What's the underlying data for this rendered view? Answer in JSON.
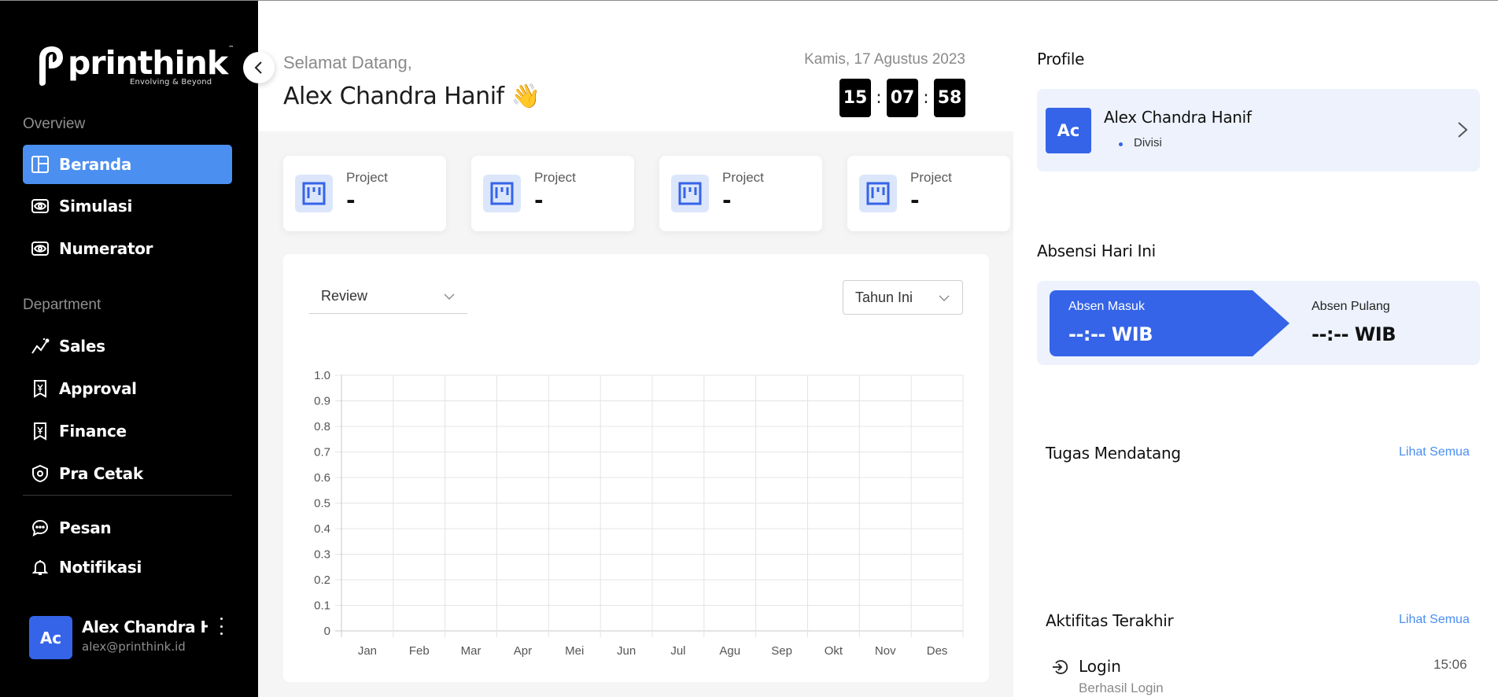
{
  "brand": {
    "name": "printhink",
    "tagline": "Envolving & Beyond",
    "tm": "™"
  },
  "sidebar": {
    "section_overview": "Overview",
    "section_department": "Department",
    "items": [
      {
        "label": "Beranda",
        "icon": "dashboard-icon",
        "active": true
      },
      {
        "label": "Simulasi",
        "icon": "eye-icon"
      },
      {
        "label": "Numerator",
        "icon": "eye-icon"
      },
      {
        "label": "Sales",
        "icon": "trend-icon"
      },
      {
        "label": "Approval",
        "icon": "yen-icon"
      },
      {
        "label": "Finance",
        "icon": "yen-icon"
      },
      {
        "label": "Pra Cetak",
        "icon": "shield-icon"
      },
      {
        "label": "Pesan",
        "icon": "chat-icon"
      },
      {
        "label": "Notifikasi",
        "icon": "bell-icon"
      }
    ],
    "user": {
      "initials": "Ac",
      "name": "Alex Chandra Hanif",
      "email": "alex@printhink.id"
    }
  },
  "header": {
    "greeting": "Selamat Datang,",
    "name": "Alex Chandra Hanif 👋",
    "date": "Kamis, 17 Agustus 2023",
    "clock": {
      "hh": "15",
      "mm": "07",
      "ss": "58"
    }
  },
  "stats": [
    {
      "label": "Project",
      "value": "-"
    },
    {
      "label": "Project",
      "value": "-"
    },
    {
      "label": "Project",
      "value": "-"
    },
    {
      "label": "Project",
      "value": "-"
    }
  ],
  "filters": {
    "type_selected": "Review",
    "period_selected": "Tahun Ini"
  },
  "chart_data": {
    "type": "bar",
    "categories": [
      "Jan",
      "Feb",
      "Mar",
      "Apr",
      "Mei",
      "Jun",
      "Jul",
      "Agu",
      "Sep",
      "Okt",
      "Nov",
      "Des"
    ],
    "values": [
      0,
      0,
      0,
      0,
      0,
      0,
      0,
      0,
      0,
      0,
      0,
      0
    ],
    "ylim": [
      0,
      1.0
    ],
    "yticks": [
      "0",
      "0.1",
      "0.2",
      "0.3",
      "0.4",
      "0.5",
      "0.6",
      "0.7",
      "0.8",
      "0.9",
      "1.0"
    ],
    "grid": true,
    "title": "",
    "xlabel": "",
    "ylabel": ""
  },
  "right": {
    "profile_title": "Profile",
    "profile": {
      "initials": "Ac",
      "name": "Alex Chandra Hanif",
      "division": "Divisi"
    },
    "attendance_title": "Absensi Hari Ini",
    "attendance": {
      "in_label": "Absen Masuk",
      "in_value": "--:-- WIB",
      "out_label": "Absen Pulang",
      "out_value": "--:-- WIB"
    },
    "tasks_title": "Tugas Mendatang",
    "tasks_link": "Lihat Semua",
    "activity_title": "Aktifitas Terakhir",
    "activity_link": "Lihat Semua",
    "activities": [
      {
        "title": "Login",
        "subtitle": "Berhasil Login",
        "time": "15:06",
        "icon": "login-icon"
      }
    ]
  },
  "colors": {
    "accent": "#4b8ff0",
    "primary": "#3564e8",
    "sidebar_bg": "#000000",
    "panel_bg": "#edf2fd"
  }
}
